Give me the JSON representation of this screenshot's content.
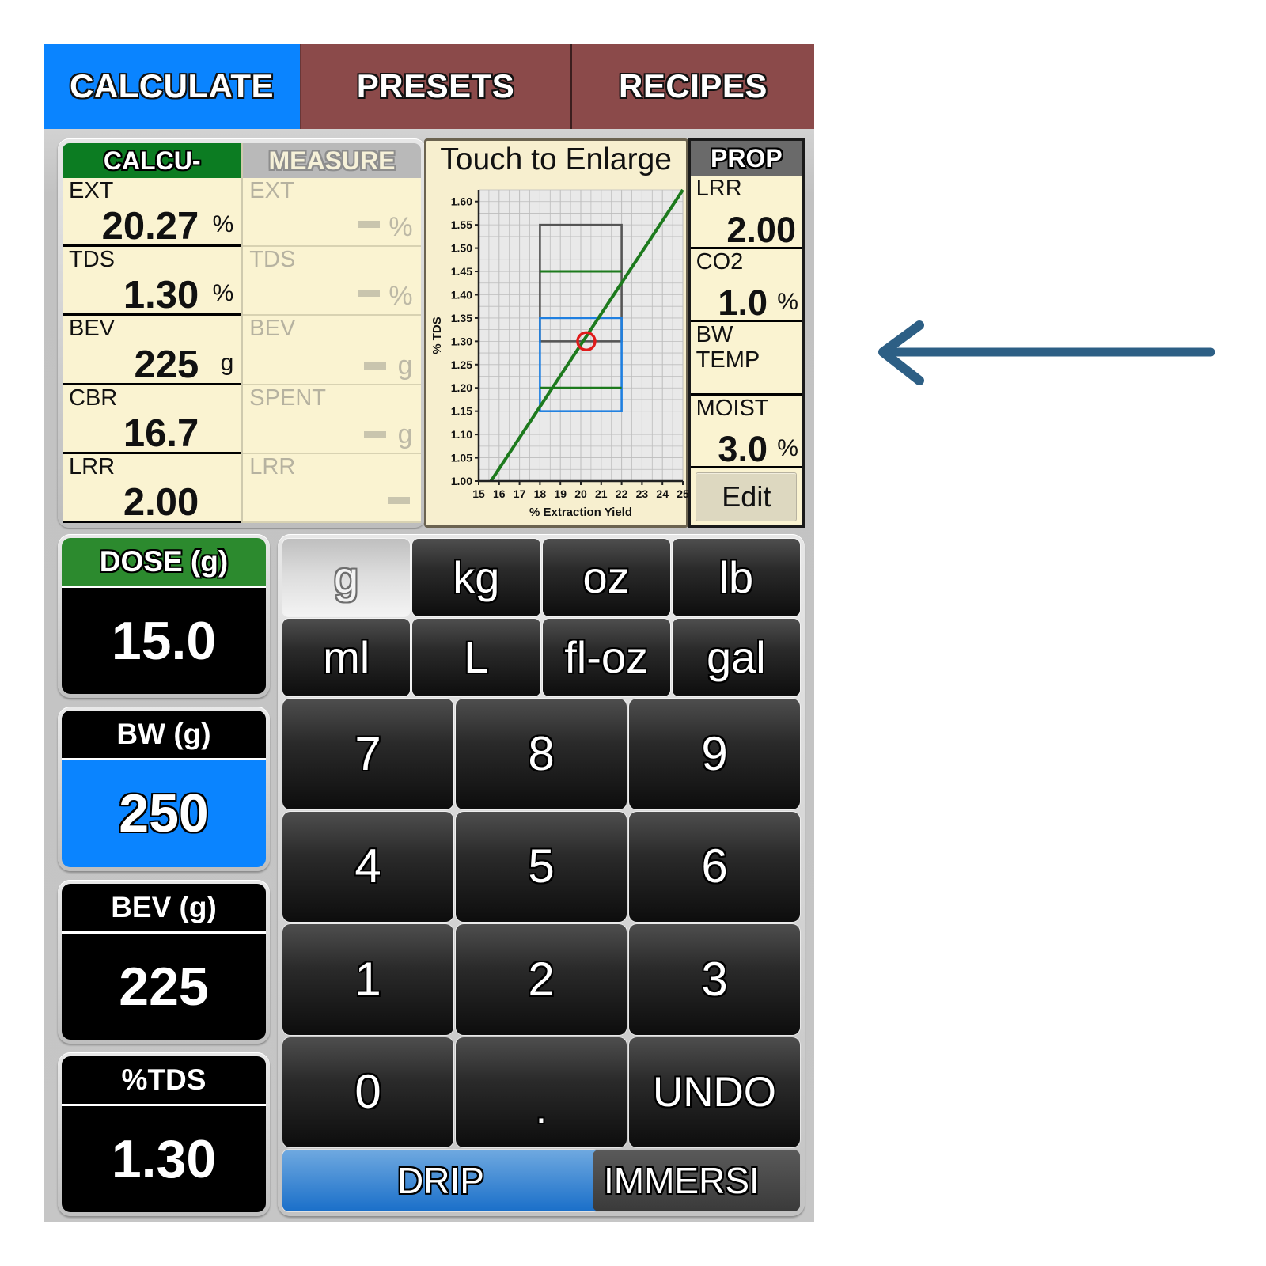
{
  "tabs": [
    {
      "label": "CALCULATE",
      "active": true
    },
    {
      "label": "PRESETS",
      "active": false
    },
    {
      "label": "RECIPES",
      "active": false
    }
  ],
  "calc_table": {
    "calc_header": "CALCU-",
    "measure_header": "MEASURE",
    "calc_rows": [
      {
        "label": "EXT",
        "value": "20.27",
        "unit": "%"
      },
      {
        "label": "TDS",
        "value": "1.30",
        "unit": "%"
      },
      {
        "label": "BEV",
        "value": "225",
        "unit": "g"
      },
      {
        "label": "CBR",
        "value": "16.7",
        "unit": ""
      },
      {
        "label": "LRR",
        "value": "2.00",
        "unit": ""
      }
    ],
    "measure_rows": [
      {
        "label": "EXT",
        "value": "",
        "unit": "%"
      },
      {
        "label": "TDS",
        "value": "",
        "unit": "%"
      },
      {
        "label": "BEV",
        "value": "",
        "unit": "g"
      },
      {
        "label": "SPENT",
        "value": "",
        "unit": "g"
      },
      {
        "label": "LRR",
        "value": "",
        "unit": ""
      }
    ]
  },
  "chart_panel": {
    "title": "Touch to Enlarge"
  },
  "chart_data": {
    "type": "line",
    "title": "Touch to Enlarge",
    "xlabel": "% Extraction Yield",
    "ylabel": "% TDS",
    "xlim": [
      15,
      25
    ],
    "ylim": [
      1.0,
      1.625
    ],
    "xticks": [
      15,
      16,
      17,
      18,
      19,
      20,
      21,
      22,
      23,
      24,
      25
    ],
    "yticks": [
      1.0,
      1.05,
      1.1,
      1.15,
      1.2,
      1.25,
      1.3,
      1.35,
      1.4,
      1.45,
      1.5,
      1.55,
      1.6
    ],
    "grid": true,
    "legend": false,
    "plot_bg": "#e9e9e9",
    "series": [
      {
        "name": "brew-strength-line",
        "type": "line",
        "color": "#1d7a1d",
        "points": [
          [
            15.6,
            1.0
          ],
          [
            25.0,
            1.625
          ]
        ]
      },
      {
        "name": "green-upper-ref-line",
        "type": "hline",
        "color": "#1d7a1d",
        "y": 1.45,
        "x_from": 18,
        "x_to": 22
      },
      {
        "name": "green-lower-ref-line",
        "type": "hline",
        "color": "#1d7a1d",
        "y": 1.2,
        "x_from": 18,
        "x_to": 22
      }
    ],
    "boxes": [
      {
        "name": "gray-target-box",
        "color": "#555555",
        "x_from": 18,
        "x_to": 22,
        "y_from": 1.3,
        "y_to": 1.55
      },
      {
        "name": "blue-target-box",
        "color": "#1f7fe0",
        "x_from": 18,
        "x_to": 22,
        "y_from": 1.15,
        "y_to": 1.35
      }
    ],
    "markers": [
      {
        "name": "current-brew-point",
        "color": "#e01b1b",
        "shape": "circle-open",
        "x": 20.27,
        "y": 1.3
      }
    ]
  },
  "prop_panel": {
    "header": "PROP",
    "rows": [
      {
        "label": "LRR",
        "label2": "",
        "value": "2.00",
        "unit": ""
      },
      {
        "label": "CO2",
        "label2": "",
        "value": "1.0",
        "unit": "%"
      },
      {
        "label": "BW",
        "label2": "TEMP",
        "value": "",
        "unit": ""
      },
      {
        "label": "MOIST",
        "label2": "",
        "value": "3.0",
        "unit": "%"
      }
    ],
    "edit_label": "Edit"
  },
  "stats": [
    {
      "label": "DOSE (g)",
      "value": "15.0",
      "label_style": "green",
      "value_style": "black"
    },
    {
      "label": "BW (g)",
      "value": "250",
      "label_style": "black",
      "value_style": "blue"
    },
    {
      "label": "BEV (g)",
      "value": "225",
      "label_style": "black",
      "value_style": "black"
    },
    {
      "label": "%TDS",
      "value": "1.30",
      "label_style": "black",
      "value_style": "black"
    }
  ],
  "keypad": {
    "units_row1": [
      {
        "label": "g",
        "selected": true
      },
      {
        "label": "kg",
        "selected": false
      },
      {
        "label": "oz",
        "selected": false
      },
      {
        "label": "lb",
        "selected": false
      }
    ],
    "units_row2": [
      {
        "label": "ml",
        "selected": false
      },
      {
        "label": "L",
        "selected": false
      },
      {
        "label": "fl-oz",
        "selected": false
      },
      {
        "label": "gal",
        "selected": false
      }
    ],
    "digits": [
      [
        "7",
        "8",
        "9"
      ],
      [
        "4",
        "5",
        "6"
      ],
      [
        "1",
        "2",
        "3"
      ],
      [
        "0",
        ".",
        "UNDO"
      ]
    ],
    "modes": [
      {
        "label": "DRIP",
        "selected": true
      },
      {
        "label": "IMMERSI",
        "selected": false
      }
    ]
  },
  "annotation": {
    "arrow_color": "#2d5f85",
    "direction": "left"
  }
}
